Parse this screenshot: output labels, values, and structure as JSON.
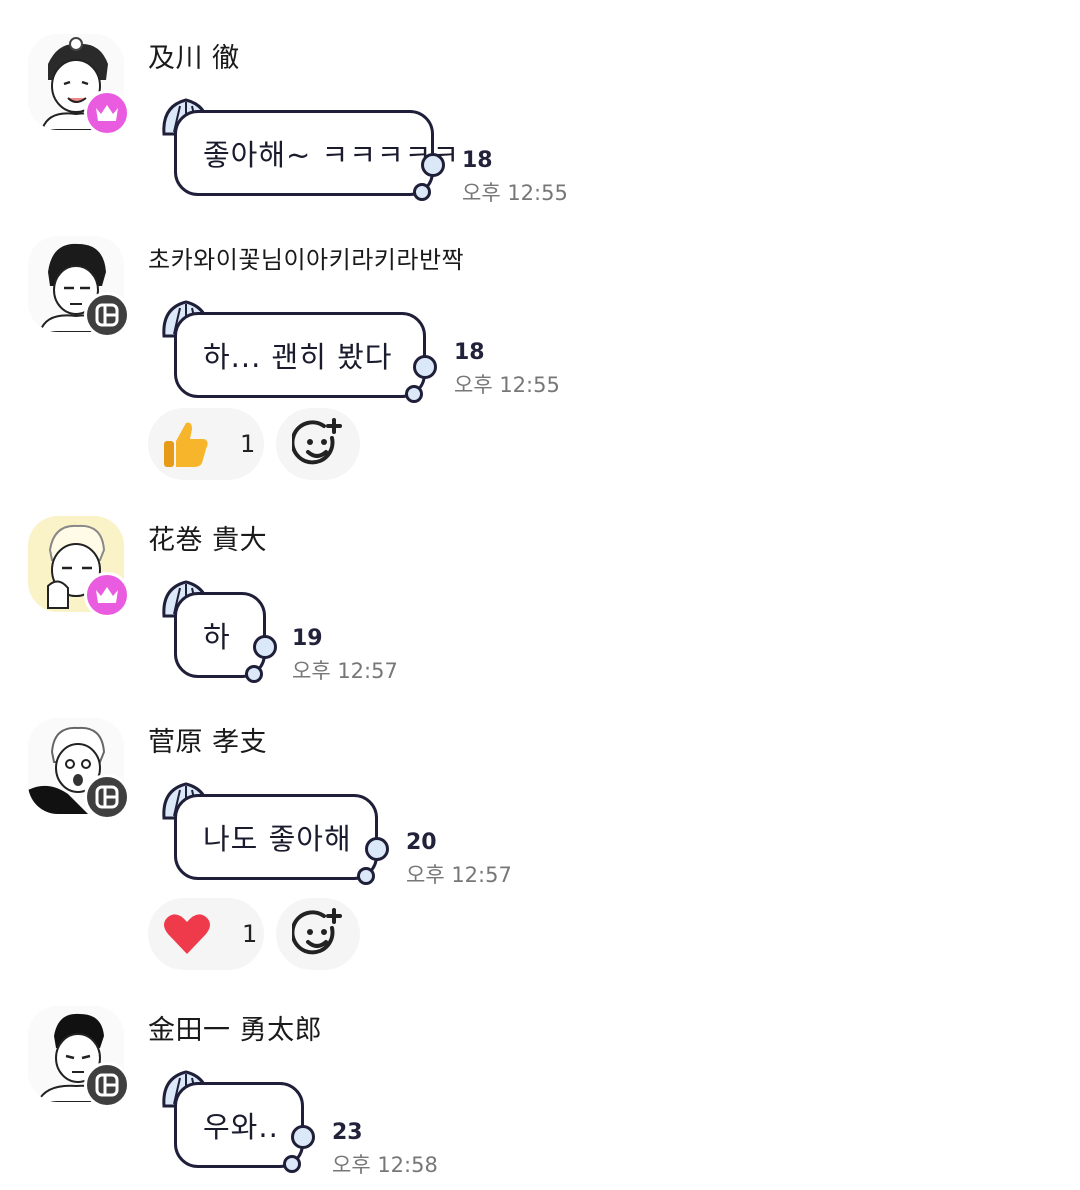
{
  "messages": [
    {
      "name": "及川 徹",
      "badge": "crown",
      "text": "좋아해~ ㅋㅋㅋㅋㅋ",
      "read_count": "18",
      "time": "오후 12:55",
      "reaction": null
    },
    {
      "name": "초카와이꽃님이아키라키라반짝",
      "badge": "host",
      "text": "하... 괜히 봤다",
      "read_count": "18",
      "time": "오후 12:55",
      "reaction": {
        "icon": "thumbs-up-icon",
        "count": "1"
      }
    },
    {
      "name": "花巻 貴大",
      "badge": "crown",
      "text": "하",
      "read_count": "19",
      "time": "오후 12:57",
      "reaction": null
    },
    {
      "name": "菅原 孝支",
      "badge": "host",
      "text": "나도 좋아해",
      "read_count": "20",
      "time": "오후 12:57",
      "reaction": {
        "icon": "heart-icon",
        "count": "1"
      }
    },
    {
      "name": "金田一 勇太郎",
      "badge": "host",
      "text": "우와..",
      "read_count": "23",
      "time": "오후 12:58",
      "reaction": null
    }
  ],
  "colors": {
    "crown_badge": "#e95ce0",
    "host_badge": "#3f3f3f",
    "bubble_border": "#1f1f3a",
    "shell": "#dbe8f7",
    "heart": "#ee3a4a",
    "thumb": "#f7b52c"
  }
}
